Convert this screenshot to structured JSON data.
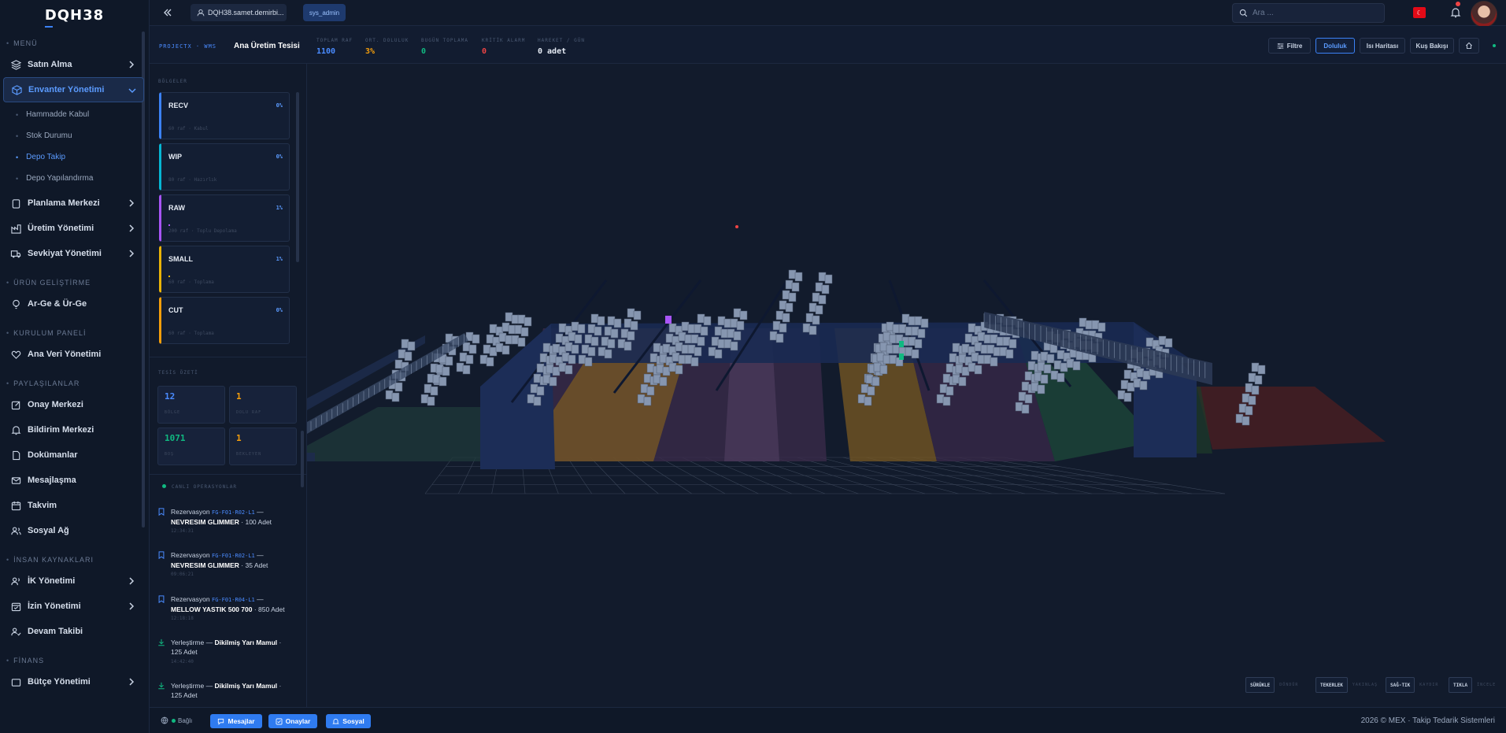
{
  "brand": "DQH38",
  "sidebar": {
    "sections": {
      "menu": "MENÜ",
      "urun": "ÜRÜN GELİŞTİRME",
      "kurulum": "KURULUM PANELİ",
      "paylasilanlar": "PAYLAŞILANLAR",
      "ik": "İNSAN KAYNAKLARI",
      "finans": "FİNANS"
    },
    "items": {
      "satin_alma": "Satın Alma",
      "envanter": "Envanter Yönetimi",
      "planlama": "Planlama Merkezi",
      "uretim": "Üretim Yönetimi",
      "sevkiyat": "Sevkiyat Yönetimi",
      "arge": "Ar-Ge & Ür-Ge",
      "ana_veri": "Ana Veri Yönetimi",
      "onay": "Onay Merkezi",
      "bildirim": "Bildirim Merkezi",
      "dokumanlar": "Dokümanlar",
      "mesajlasma": "Mesajlaşma",
      "takvim": "Takvim",
      "sosyal": "Sosyal Ağ",
      "ik_yonetimi": "İK Yönetimi",
      "izin": "İzin Yönetimi",
      "devam": "Devam Takibi",
      "butce": "Bütçe Yönetimi"
    },
    "sub_items": {
      "hammadde": "Hammadde Kabul",
      "stok": "Stok Durumu",
      "depo_takip": "Depo Takip",
      "depo_yap": "Depo Yapılandırma"
    }
  },
  "header": {
    "user": "DQH38.samet.demirbi...",
    "role": "sys_admin",
    "search_placeholder": "Ara ..."
  },
  "strip": {
    "crumb": "PROJECTX · WMS",
    "facility": "Ana Üretim Tesisi",
    "kpis": [
      {
        "label": "TOPLAM RAF",
        "value": "1100",
        "color": "#4a8bff"
      },
      {
        "label": "ORT. DOLULUK",
        "value": "3%",
        "color": "#f59e0b"
      },
      {
        "label": "BUGÜN TOPLAMA",
        "value": "0",
        "color": "#10b981"
      },
      {
        "label": "KRİTİK ALARM",
        "value": "0",
        "color": "#ef4444"
      },
      {
        "label": "HAREKET / GÜN",
        "value": "0 adet",
        "color": "#e6ecf5"
      }
    ],
    "buttons": {
      "filter": "Filtre",
      "fill": "Doluluk",
      "heat": "Isı Haritası",
      "bird": "Kuş Bakışı"
    }
  },
  "panel": {
    "zones_label": "BÖLGELER",
    "zones": [
      {
        "name": "RECV",
        "pct": "0%",
        "desc": "60 raf · Kabul",
        "color": "#3b82f6",
        "fill": 0
      },
      {
        "name": "WIP",
        "pct": "0%",
        "desc": "80 raf · Hazırlık",
        "color": "#06b6d4",
        "fill": 0
      },
      {
        "name": "RAW",
        "pct": "1%",
        "desc": "200 raf · Toplu Depolama",
        "color": "#a855f7",
        "fill": 1
      },
      {
        "name": "SMALL",
        "pct": "1%",
        "desc": "60 raf · Toplama",
        "color": "#eab308",
        "fill": 1
      },
      {
        "name": "CUT",
        "pct": "0%",
        "desc": "60 raf · Toplama",
        "color": "#f59e0b",
        "fill": 0
      }
    ],
    "summary_label": "TESİS ÖZETİ",
    "summary": [
      {
        "value": "12",
        "label": "BÖLGE",
        "color": "#4a8bff"
      },
      {
        "value": "1",
        "label": "DOLU RAF",
        "color": "#f59e0b"
      },
      {
        "value": "1071",
        "label": "BOŞ",
        "color": "#10b981"
      },
      {
        "value": "1",
        "label": "BEKLEYEN",
        "color": "#f59e0b"
      }
    ],
    "live_label": "CANLI OPERASYONLAR",
    "ops": [
      {
        "type": "Rezervasyon",
        "code": "FG-F01-R02-L1",
        "item": "NEVRESIM GLIMMER",
        "qty": "· 100 Adet",
        "time": "12:34:31"
      },
      {
        "type": "Rezervasyon",
        "code": "FG-F01-R02-L1",
        "item": "NEVRESIM GLIMMER",
        "qty": "· 35 Adet",
        "time": "09:06:21"
      },
      {
        "type": "Rezervasyon",
        "code": "FG-F01-R04-L1",
        "item": "MELLOW YASTIK 500 700",
        "qty": "· 850 Adet",
        "time": "12:18:18"
      },
      {
        "type": "Yerleştirme",
        "code": "",
        "item": "Dikilmiş Yarı Mamul",
        "qty": "· 125 Adet",
        "time": "14:42:40"
      },
      {
        "type": "Yerleştirme",
        "code": "",
        "item": "Dikilmiş Yarı Mamul",
        "qty": "· 125 Adet",
        "time": ""
      }
    ],
    "dash": "—"
  },
  "viewport": {
    "controls": [
      {
        "key": "SÜRÜKLE",
        "desc": "DÖNDÜR"
      },
      {
        "key": "TEKERLEK",
        "desc": "YAKINLAŞ"
      },
      {
        "key": "SAĞ-TIK",
        "desc": "KAYDIR"
      },
      {
        "key": "TIKLA",
        "desc": "İNCELE"
      }
    ]
  },
  "footer": {
    "net": "Bağlı",
    "buttons": {
      "messages": "Mesajlar",
      "approvals": "Onaylar",
      "social": "Sosyal"
    },
    "copyright": "2026 © MEX  ·  Takip Tedarik Sistemleri"
  },
  "colors": {
    "accent": "#3b82f6",
    "bg": "#111a2b",
    "sidebar": "#0f1828"
  }
}
